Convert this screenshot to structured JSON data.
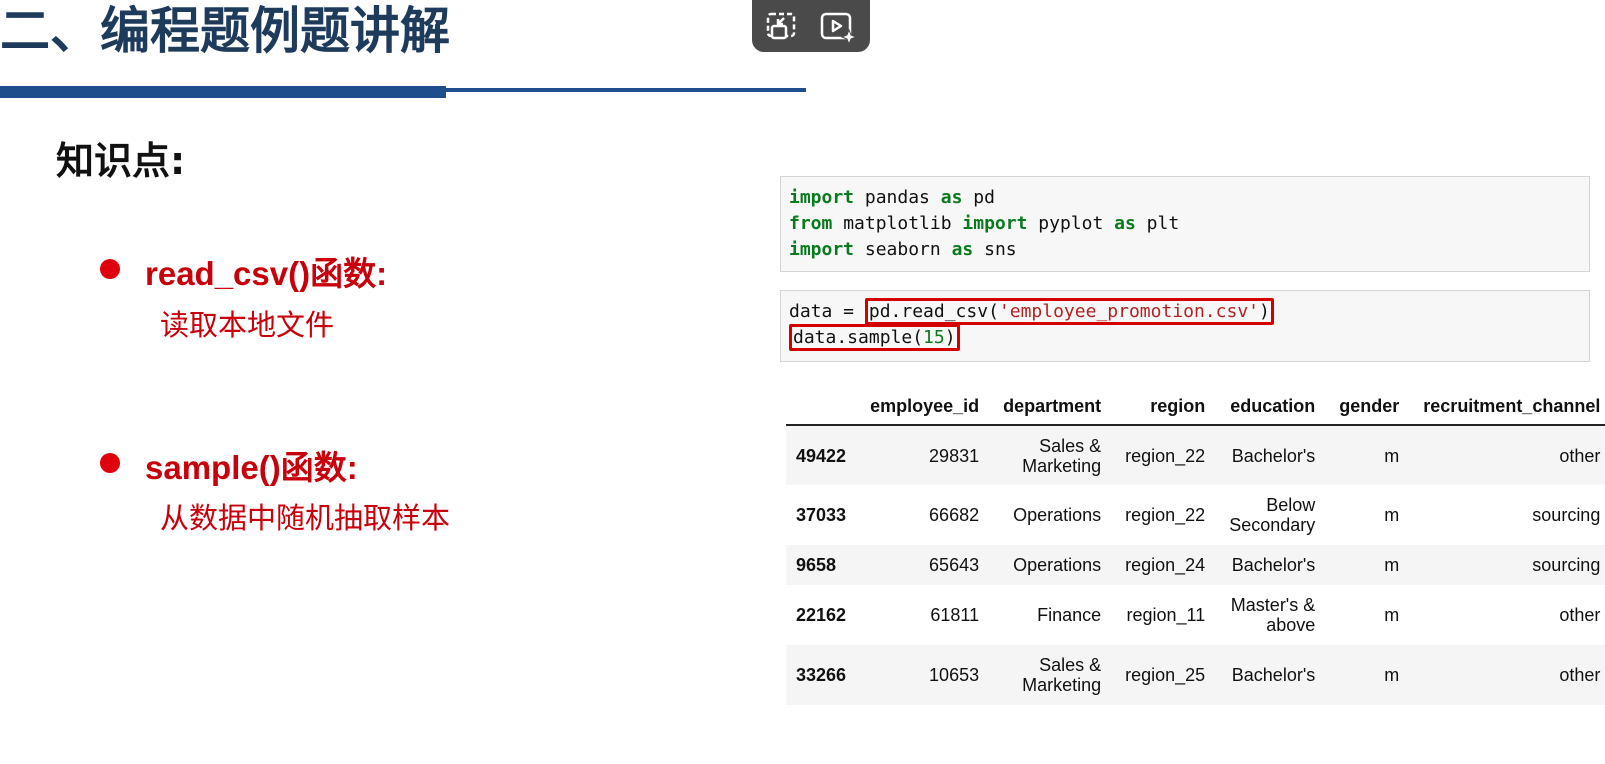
{
  "slide": {
    "title": "二、编程题例题讲解",
    "knowledge_heading": "知识点:",
    "bullets": [
      {
        "title": "read_csv()函数:",
        "desc": "读取本地文件"
      },
      {
        "title": "sample()函数:",
        "desc": "从数据中随机抽取样本"
      }
    ]
  },
  "video_controls": {
    "buttons": [
      {
        "icon": "picture-in-picture-icon"
      },
      {
        "icon": "video-sparkle-icon"
      }
    ]
  },
  "notebook": {
    "cell1_lines": [
      [
        "import",
        " pandas ",
        "as",
        " pd"
      ],
      [
        "from",
        " matplotlib ",
        "import",
        " pyplot ",
        "as",
        " plt"
      ],
      [
        "import",
        " seaborn ",
        "as",
        " sns"
      ]
    ],
    "cell2": {
      "line1_prefix": "data = ",
      "line1_call": "pd.read_csv(",
      "line1_string": "'employee_promotion.csv'",
      "line1_close": ")",
      "line2_call": "data.sample(",
      "line2_num": "15",
      "line2_close": ")"
    },
    "table": {
      "columns": [
        "",
        "employee_id",
        "department",
        "region",
        "education",
        "gender",
        "recruitment_channel"
      ],
      "rows": [
        [
          "49422",
          "29831",
          "Sales & Marketing",
          "region_22",
          "Bachelor's",
          "m",
          "other"
        ],
        [
          "37033",
          "66682",
          "Operations",
          "region_22",
          "Below Secondary",
          "m",
          "sourcing"
        ],
        [
          "9658",
          "65643",
          "Operations",
          "region_24",
          "Bachelor's",
          "m",
          "sourcing"
        ],
        [
          "22162",
          "61811",
          "Finance",
          "region_11",
          "Master's & above",
          "m",
          "other"
        ],
        [
          "33266",
          "10653",
          "Sales & Marketing",
          "region_25",
          "Bachelor's",
          "m",
          "other"
        ]
      ]
    }
  }
}
